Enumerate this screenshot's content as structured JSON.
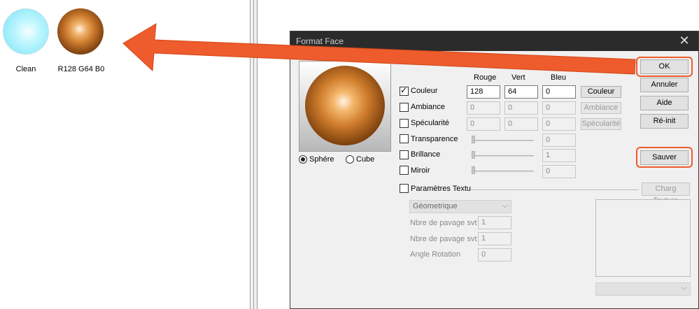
{
  "library": {
    "items": [
      {
        "label": "Clean"
      },
      {
        "label": "R128 G64 B0"
      }
    ]
  },
  "dialog": {
    "title": "Format Face",
    "close_glyph": "✕",
    "preview": {
      "sphere_label": "Sphére",
      "cube_label": "Cube",
      "selected": "sphere"
    },
    "columns": {
      "red": "Rouge",
      "green": "Vert",
      "blue": "Bleu"
    },
    "rows": {
      "couleur": {
        "label": "Couleur",
        "checked": true,
        "red": "128",
        "green": "64",
        "blue": "0",
        "button": "Couleur"
      },
      "ambiance": {
        "label": "Ambiance",
        "checked": false,
        "red": "0",
        "green": "0",
        "blue": "0",
        "button": "Ambiance"
      },
      "specularite": {
        "label": "Spécularité",
        "checked": false,
        "red": "0",
        "green": "0",
        "blue": "0",
        "button": "Spécularité"
      },
      "transparence": {
        "label": "Transparence",
        "checked": false,
        "value": "0"
      },
      "brillance": {
        "label": "Brillance",
        "checked": false,
        "value": "1"
      },
      "miroir": {
        "label": "Miroir",
        "checked": false,
        "value": "0"
      }
    },
    "texture": {
      "label": "Paramètres Textu",
      "load_button": "Charg Texture",
      "mapping_selected": "Géometrique",
      "tiling1_label": "Nbre de pavage svt",
      "tiling1_value": "1",
      "tiling2_label": "Nbre de pavage svt",
      "tiling2_value": "1",
      "rotation_label": "Angle Rotation",
      "rotation_value": "0"
    },
    "buttons": {
      "ok": "OK",
      "cancel": "Annuler",
      "help": "Aide",
      "reset": "Ré-init",
      "save": "Sauver"
    }
  },
  "annotation": {
    "color": "#ee5b2c"
  }
}
